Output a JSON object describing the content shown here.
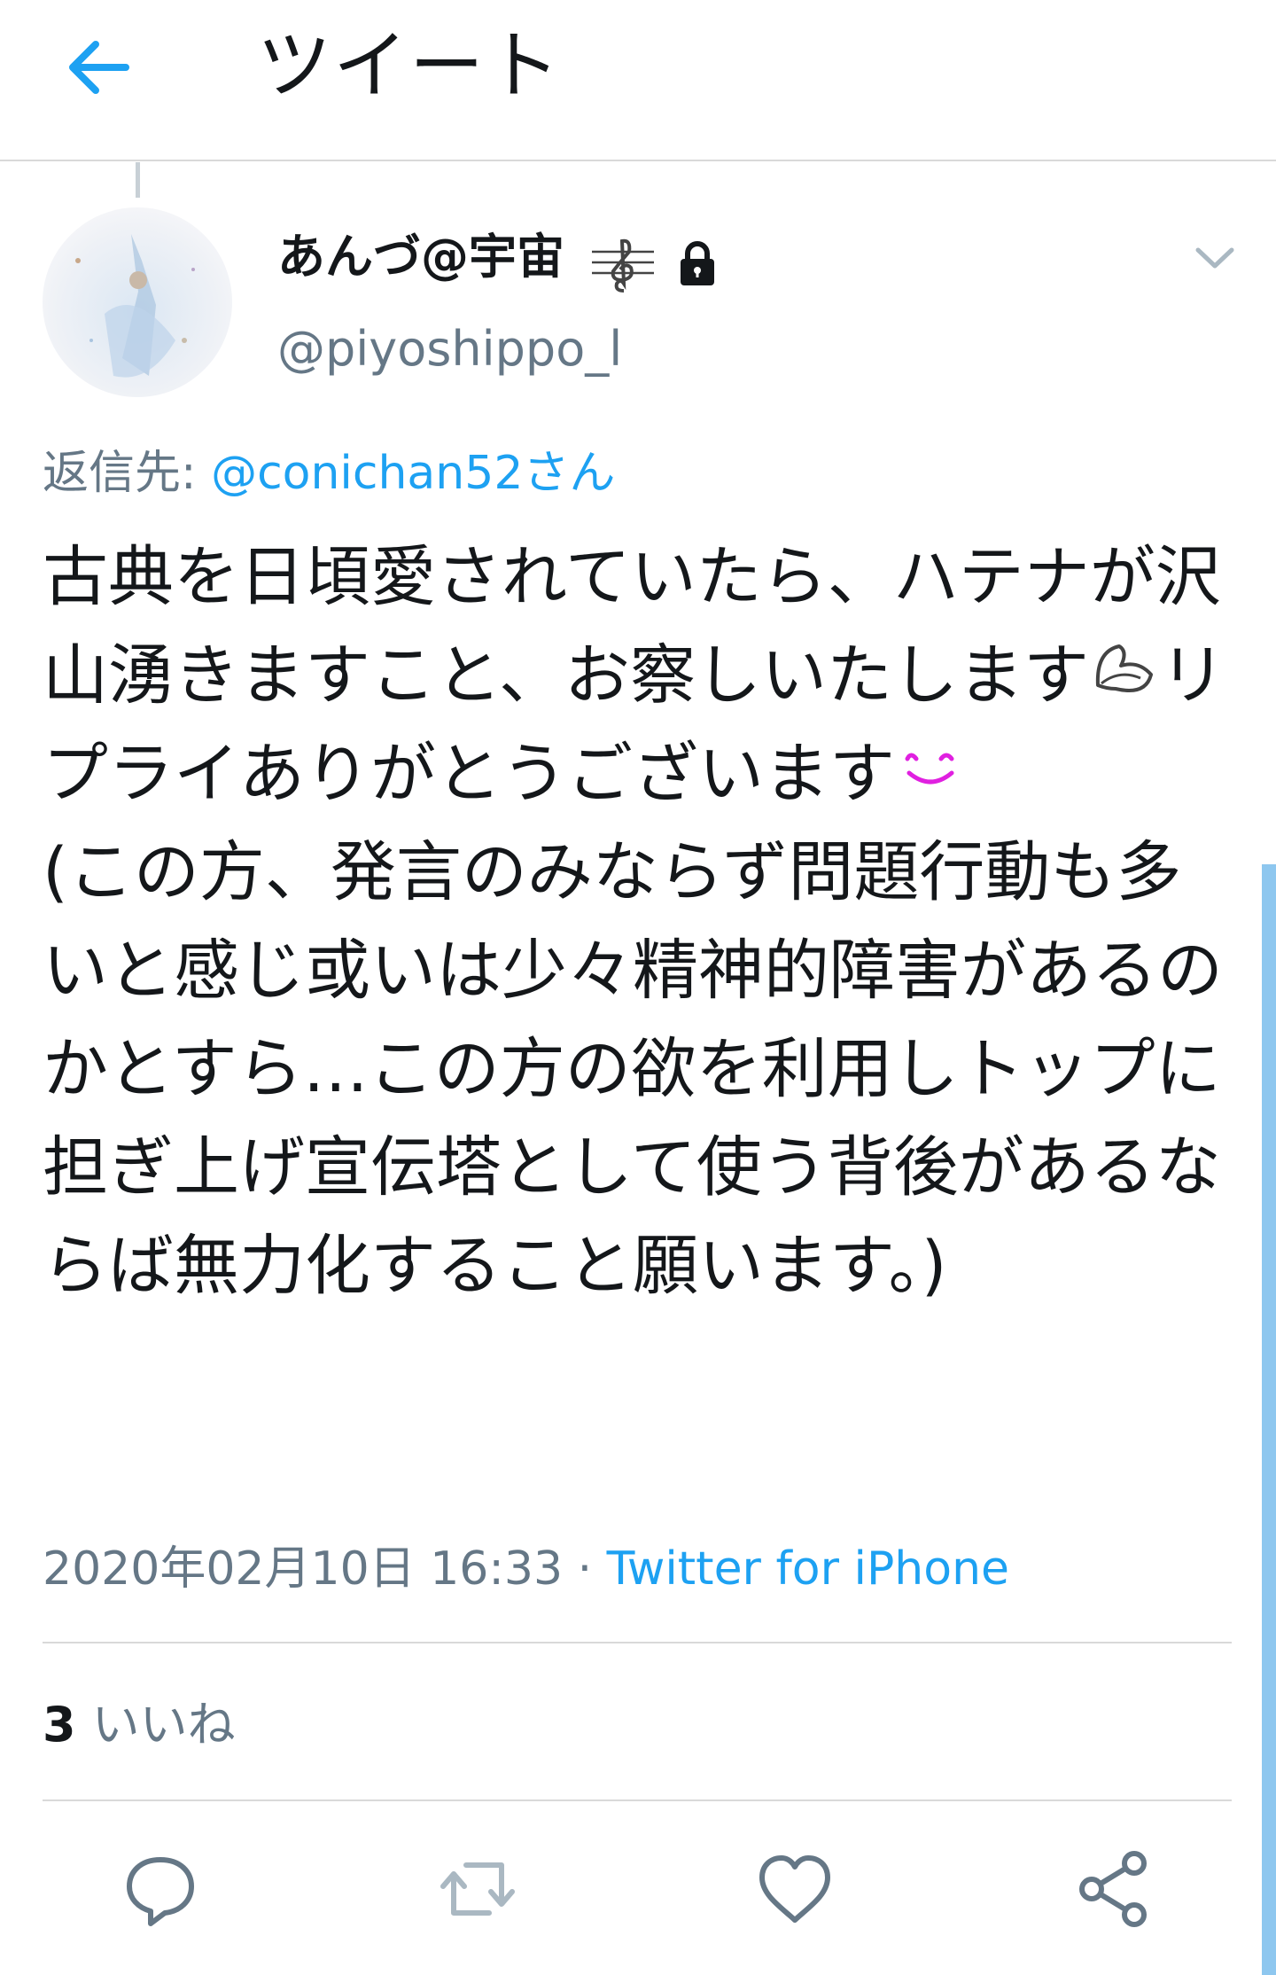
{
  "header": {
    "title": "ツイート"
  },
  "user": {
    "display_name": "あんづ@宇宙",
    "handle": "@piyoshippo_l"
  },
  "reply": {
    "prefix": "返信先: ",
    "mention": "@conichan52さん"
  },
  "tweet": {
    "part1": "古典を日頃愛されていたら、ハテナが沢山湧きますこと、お察しいたします",
    "part2": "リプライありがとうございます",
    "part3": "\n(この方、発言のみならず問題行動も多いと感じ或いは少々精神的障害があるのかとすら…この方の欲を利用しトップに担ぎ上げ宣伝塔として使う背後があるならば無力化すること願います。)"
  },
  "meta": {
    "timestamp": "2020年02月10日 16:33",
    "separator": " · ",
    "source": "Twitter for iPhone"
  },
  "stats": {
    "likes_count": "3",
    "likes_label": "いいね"
  },
  "icons": [
    "back-arrow-icon",
    "treble-clef-icon",
    "lock-icon",
    "chevron-down-icon",
    "reply-icon",
    "retweet-icon",
    "like-icon",
    "share-icon"
  ],
  "colors": {
    "accent": "#1da1f2",
    "secondary_text": "#657786",
    "divider": "#d9d9d9"
  }
}
